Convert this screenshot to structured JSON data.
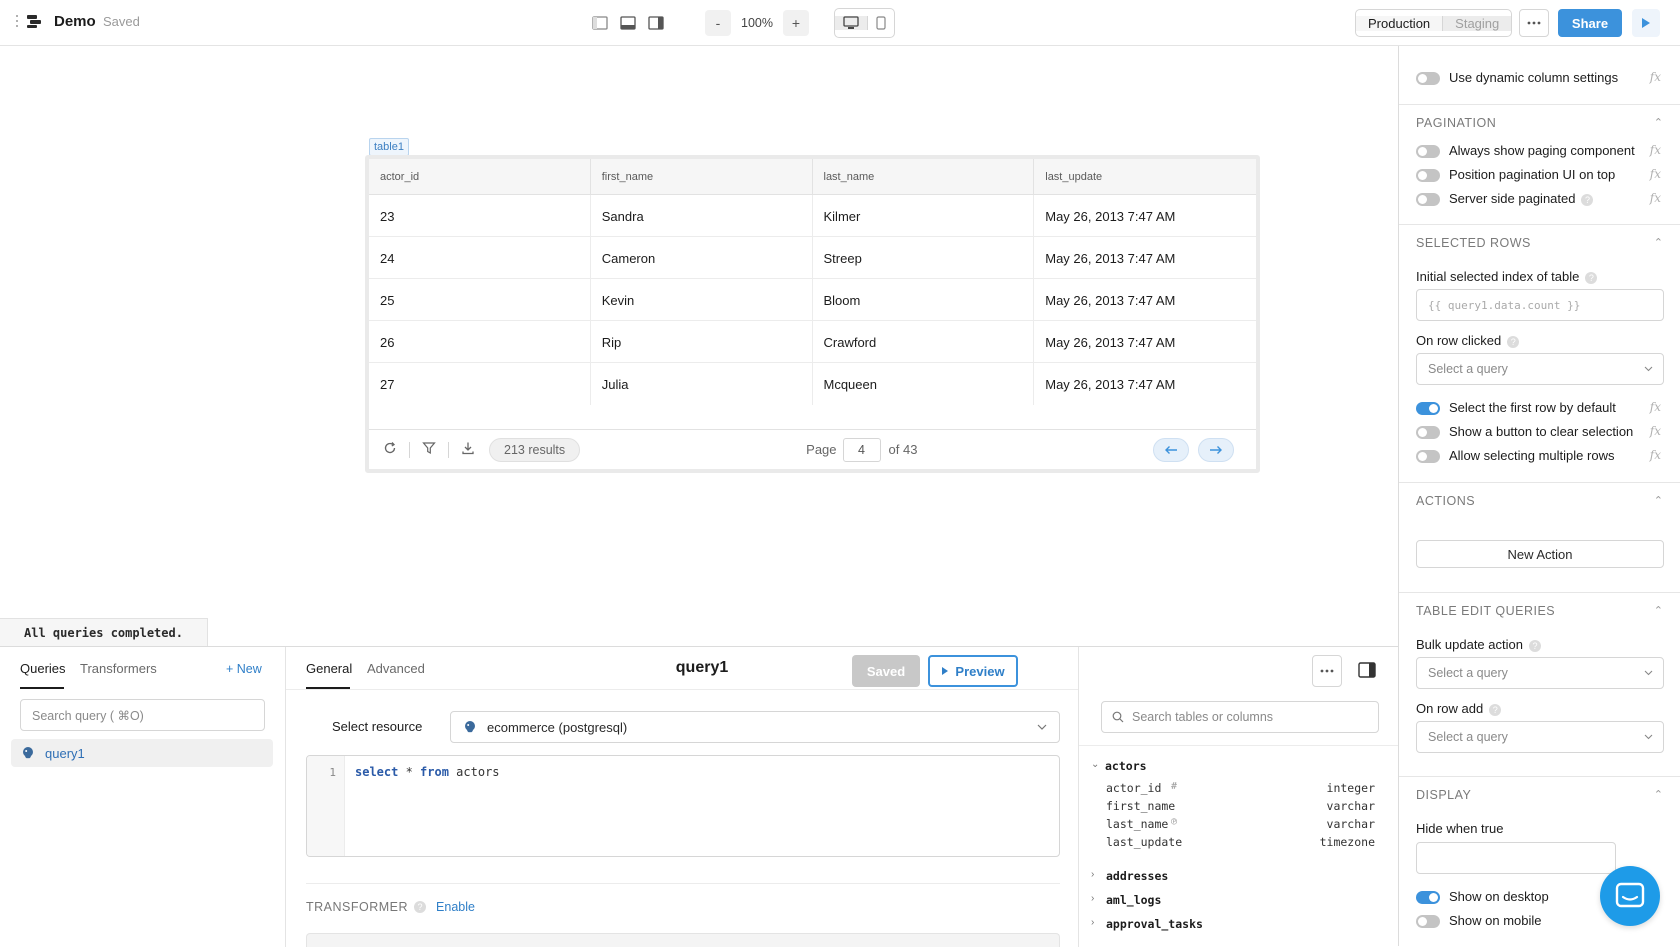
{
  "app": {
    "title": "Demo",
    "save_status": "Saved",
    "zoom": "100%",
    "zoom_out": "-",
    "zoom_in": "+"
  },
  "env": {
    "production": "Production",
    "staging": "Staging",
    "share": "Share"
  },
  "canvas": {
    "table_tag": "table1",
    "columns": [
      "actor_id",
      "first_name",
      "last_name",
      "last_update"
    ],
    "rows": [
      [
        "23",
        "Sandra",
        "Kilmer",
        "May 26, 2013 7:47 AM"
      ],
      [
        "24",
        "Cameron",
        "Streep",
        "May 26, 2013 7:47 AM"
      ],
      [
        "25",
        "Kevin",
        "Bloom",
        "May 26, 2013 7:47 AM"
      ],
      [
        "26",
        "Rip",
        "Crawford",
        "May 26, 2013 7:47 AM"
      ],
      [
        "27",
        "Julia",
        "Mcqueen",
        "May 26, 2013 7:47 AM"
      ]
    ],
    "results": "213 results",
    "page_label": "Page",
    "page_value": "4",
    "page_of": "of 43"
  },
  "toast": "All queries completed.",
  "queries": {
    "tab_queries": "Queries",
    "tab_transformers": "Transformers",
    "new_label": "+ New",
    "search_placeholder": "Search query ( ⌘O)",
    "items": [
      "query1"
    ]
  },
  "editor": {
    "tab_general": "General",
    "tab_advanced": "Advanced",
    "query_name": "query1",
    "saved_btn": "Saved",
    "preview_btn": "Preview",
    "resource_label": "Select resource",
    "resource_value": "ecommerce (postgresql)",
    "line_no": "1",
    "code_kw1": "select",
    "code_mid": " * ",
    "code_kw2": "from",
    "code_tail": " actors",
    "transformer_label": "TRANSFORMER",
    "transformer_enable": "Enable"
  },
  "schema": {
    "search_placeholder": "Search tables or columns",
    "open_table": "actors",
    "columns": [
      {
        "name": "actor_id",
        "type": "integer"
      },
      {
        "name": "first_name",
        "type": "varchar"
      },
      {
        "name": "last_name",
        "type": "varchar"
      },
      {
        "name": "last_update",
        "type": "timezone"
      }
    ],
    "other_tables": [
      "addresses",
      "aml_logs",
      "approval_tasks"
    ]
  },
  "inspector": {
    "dynamic_cols": "Use dynamic column settings",
    "pagination": {
      "title": "PAGINATION",
      "always_show": "Always show paging component",
      "position_top": "Position pagination UI on top",
      "server_side": "Server side paginated"
    },
    "selected_rows": {
      "title": "SELECTED ROWS",
      "initial_index_label": "Initial selected index of table",
      "initial_index_placeholder": "{{ query1.data.count }}",
      "on_row_clicked": "On row clicked",
      "select_query": "Select a query",
      "select_first": "Select the first row by default",
      "show_clear": "Show a button to clear selection",
      "allow_multi": "Allow selecting multiple rows"
    },
    "actions": {
      "title": "ACTIONS",
      "new_action": "New Action"
    },
    "table_edit": {
      "title": "TABLE EDIT QUERIES",
      "bulk_update": "Bulk update action",
      "bulk_select": "Select a query",
      "on_row_add": "On row add",
      "row_add_select": "Select a query"
    },
    "display": {
      "title": "DISPLAY",
      "hide_when_true": "Hide when true",
      "show_desktop": "Show on desktop",
      "show_mobile": "Show on mobile"
    },
    "fx": "fx"
  }
}
